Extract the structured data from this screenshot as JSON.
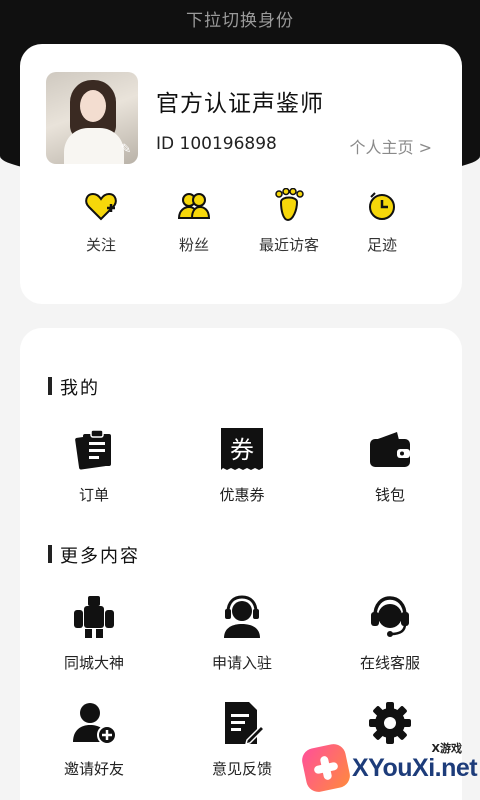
{
  "header": {
    "pull_hint": "下拉切换身份"
  },
  "profile": {
    "name": "官方认证声鉴师",
    "id_text": "ID 100196898",
    "homepage_link": "个人主页 >"
  },
  "quick_actions": [
    {
      "label": "关注",
      "icon": "heart-plus-icon"
    },
    {
      "label": "粉丝",
      "icon": "users-icon"
    },
    {
      "label": "最近访客",
      "icon": "footprint-icon"
    },
    {
      "label": "足迹",
      "icon": "clock-icon"
    }
  ],
  "sections": {
    "mine": {
      "title": "我的",
      "items": [
        {
          "label": "订单",
          "icon": "order-icon"
        },
        {
          "label": "优惠券",
          "icon": "coupon-icon"
        },
        {
          "label": "钱包",
          "icon": "wallet-icon"
        }
      ]
    },
    "more": {
      "title": "更多内容",
      "items": [
        {
          "label": "同城大神",
          "icon": "robot-icon"
        },
        {
          "label": "申请入驻",
          "icon": "headset-user-icon"
        },
        {
          "label": "在线客服",
          "icon": "customer-service-icon"
        },
        {
          "label": "邀请好友",
          "icon": "add-user-icon"
        },
        {
          "label": "意见反馈",
          "icon": "feedback-icon"
        },
        {
          "label": "",
          "icon": "gear-icon"
        }
      ]
    }
  },
  "watermark": {
    "small_text": "X游戏",
    "main_text": "XYouXi.net"
  },
  "colors": {
    "accent_yellow": "#f6d70a",
    "dark_bg": "#101010"
  }
}
